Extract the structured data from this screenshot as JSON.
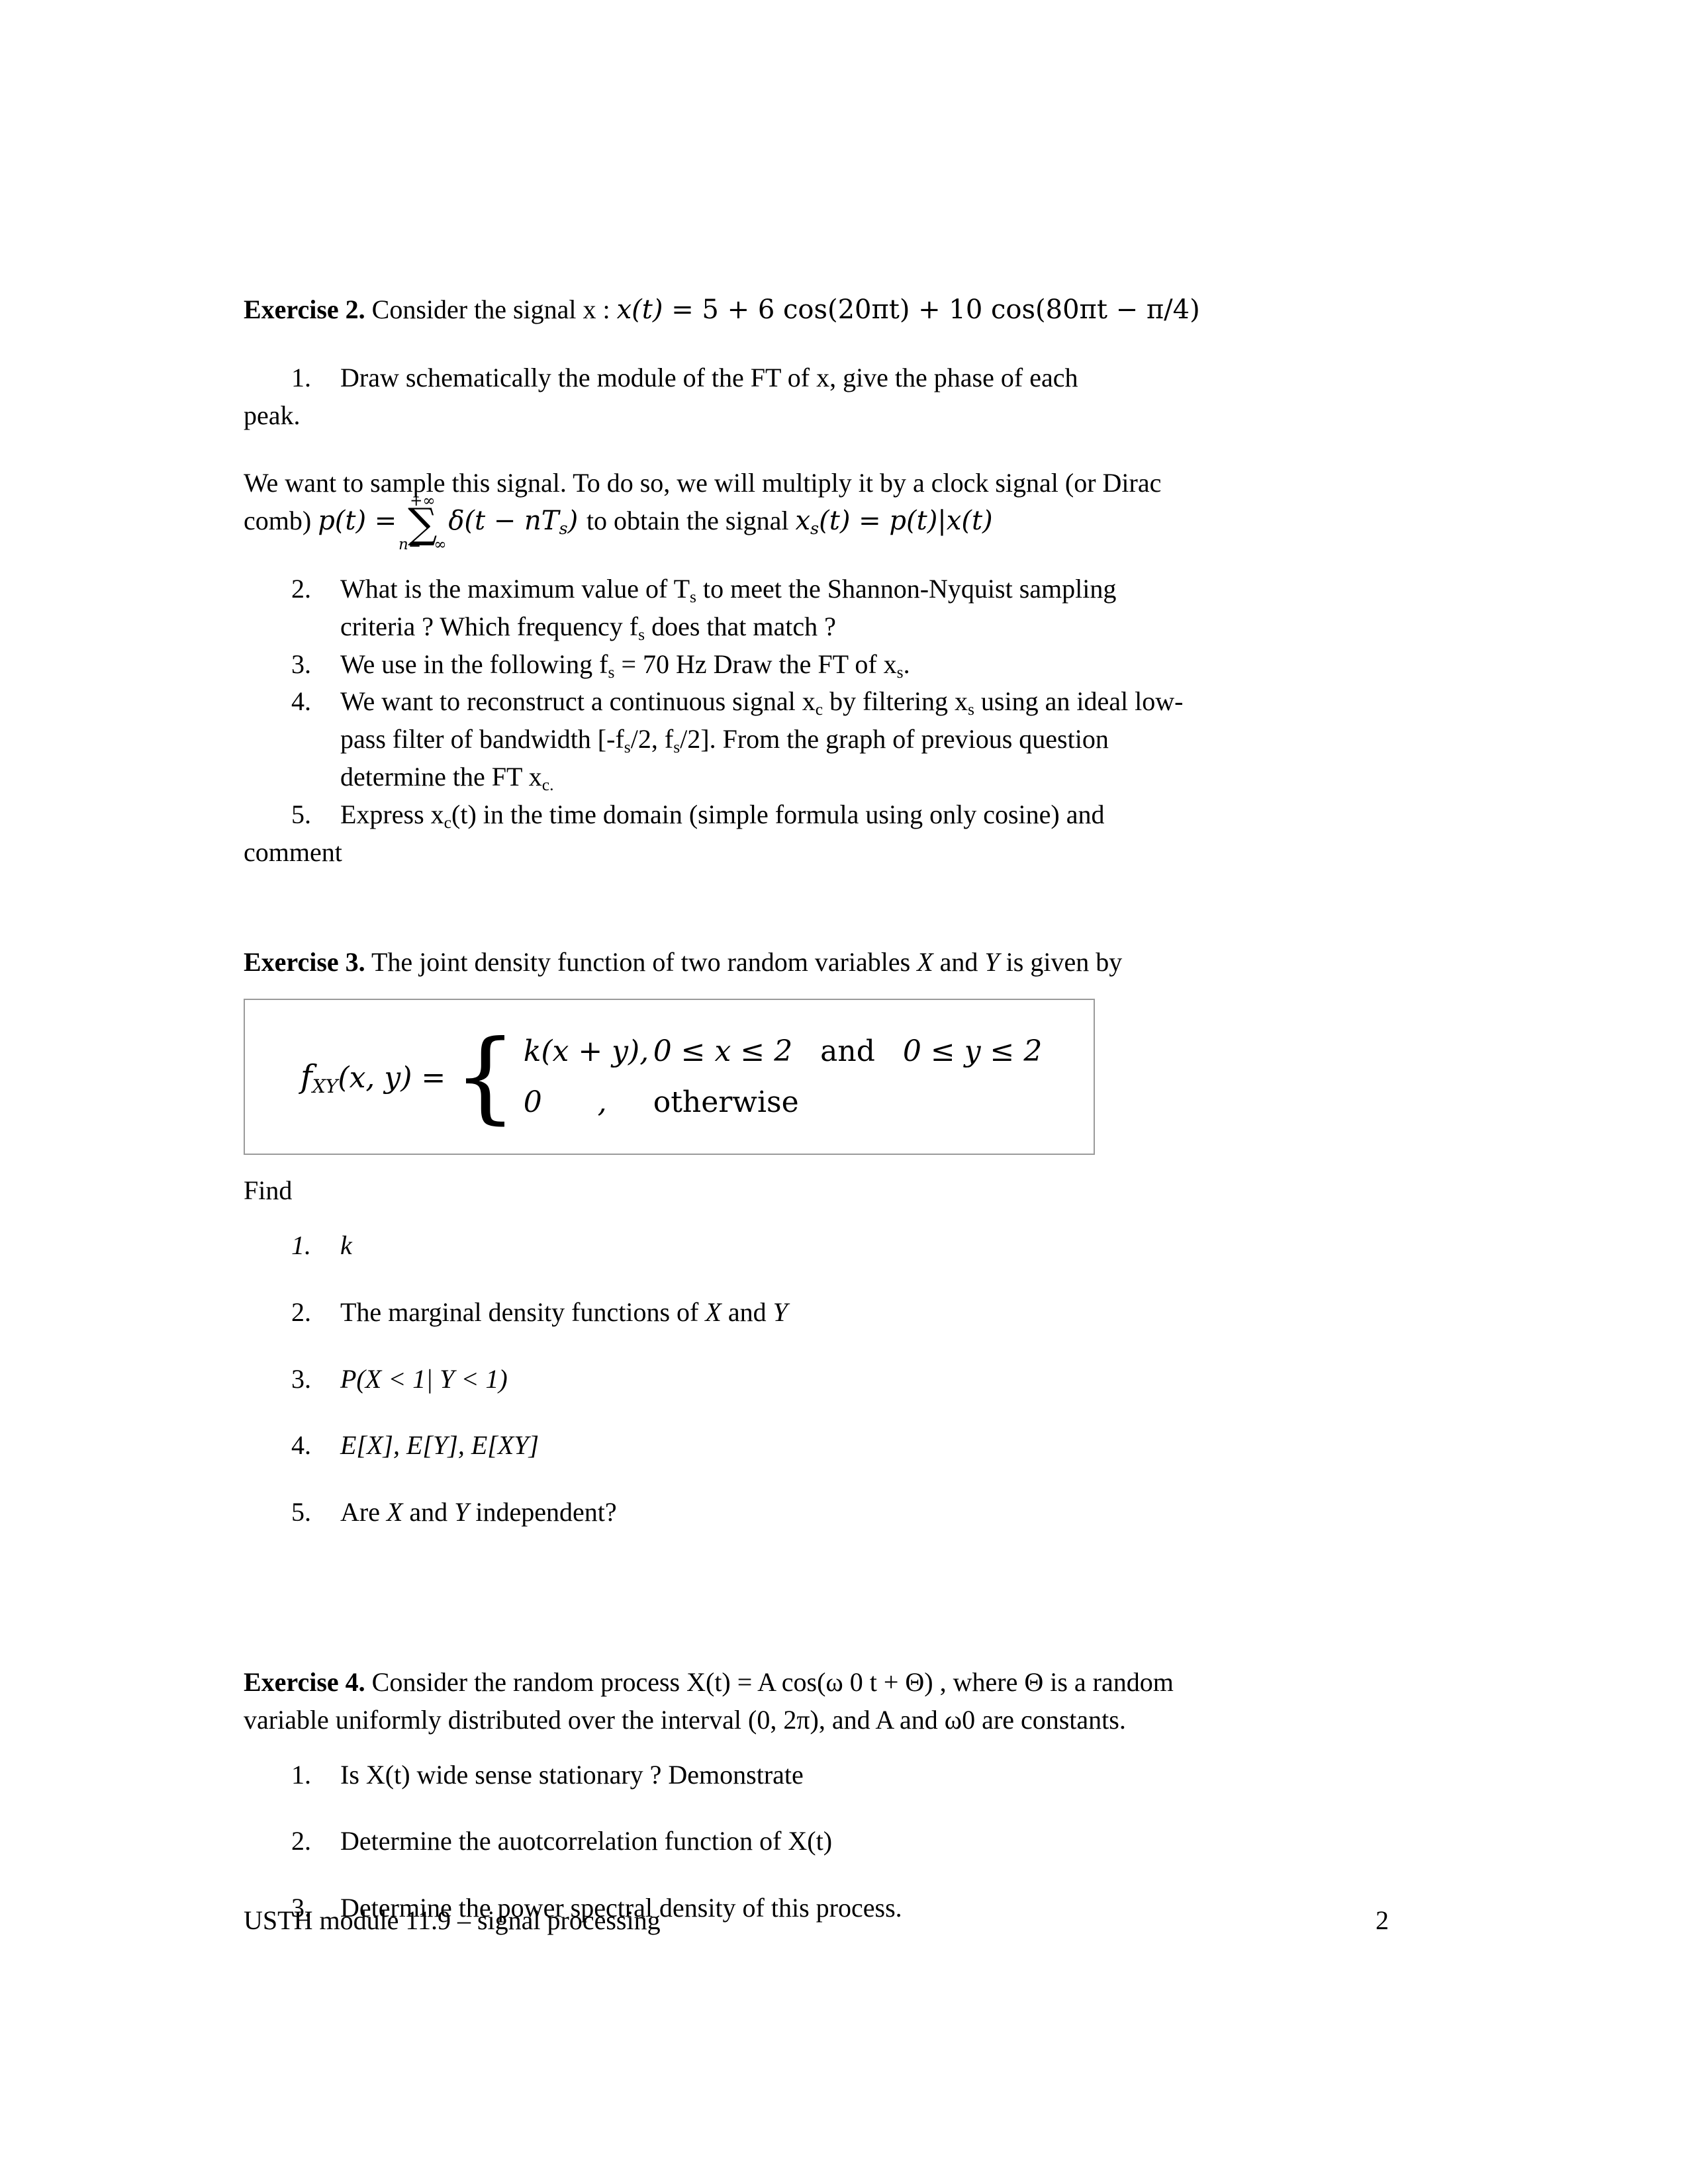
{
  "document": {
    "page_number": "2",
    "footer_text": "USTH module 11.9 – signal processing"
  },
  "exercise2": {
    "label": "Exercise 2.",
    "intro": "Consider the signal x :",
    "signal_formula": {
      "lhs": "x(t)",
      "eq": "=",
      "rhs": "5 + 6 cos(20πt) + 10 cos(80πt − π/4)"
    },
    "q1": "Draw schematically the module of the FT of x, give the phase of each",
    "q1_cont": "peak.",
    "sampling_para_1": "We want to sample this signal. To do so, we will multiply it by a clock signal (or Dirac",
    "sampling_para_2_prefix": "comb)",
    "comb_formula": {
      "lhs": "p(t)",
      "eq": "=",
      "sum_upper": "+∞",
      "sum_lower": "n=−∞",
      "term": "δ(t − nT",
      "term_sub": "s",
      "term_close": ")"
    },
    "sampling_para_2_mid": "to obtain the signal",
    "sampled_formula": {
      "lhs": "x",
      "lhs_sub": "s",
      "lhs_arg": "(t)",
      "eq": "=",
      "rhs": "p(t)|x(t)"
    },
    "questions": [
      {
        "num": "2.",
        "line1_a": "What is the maximum value of T",
        "line1_sub": "s",
        "line1_b": " to meet the Shannon-Nyquist sampling",
        "line2_a": "criteria ? Which frequency f",
        "line2_sub": "s",
        "line2_b": " does that match ?"
      },
      {
        "num": "3.",
        "line1_a": "We use in the following f",
        "line1_sub": "s",
        "line1_b": " = 70 Hz Draw the FT of x",
        "line1_sub2": "s",
        "line1_c": "."
      },
      {
        "num": "4.",
        "line1_a": "We want to reconstruct a continuous signal x",
        "line1_sub": "c",
        "line1_b": " by filtering x",
        "line1_sub2": "s",
        "line1_c": " using an ideal low-",
        "line2_a": "pass filter of bandwidth [-f",
        "line2_sub": "s",
        "line2_b": "/2, f",
        "line2_sub2": "s",
        "line2_c": "/2]. From the graph of previous question",
        "line3_a": "determine the FT x",
        "line3_sub": "c.",
        "line3_b": ""
      },
      {
        "num": "5.",
        "line1_a": "Express x",
        "line1_sub": "c",
        "line1_b": "(t) in the time domain (simple formula using only cosine) and"
      }
    ],
    "q5_cont": "comment"
  },
  "exercise3": {
    "label": "Exercise 3.",
    "intro_a": "The joint density function of two random variables ",
    "intro_x": "X",
    "intro_b": " and ",
    "intro_y": "Y",
    "intro_c": " is given by",
    "formula": {
      "lhs_f": "f",
      "lhs_sub": "XY",
      "lhs_args": "(x, y)",
      "eq": "=",
      "case1_value": "k(x + y),",
      "case1_condition_a": "0 ≤ x ≤ 2",
      "case1_condition_and": "and",
      "case1_condition_b": "0 ≤ y ≤ 2",
      "case2_value": "0",
      "case2_comma": ",",
      "case2_condition": "otherwise"
    },
    "find_label": "Find",
    "items": [
      {
        "num": "1.",
        "text": "k",
        "italic": true
      },
      {
        "num": "2.",
        "text_a": "The marginal density functions of ",
        "text_x": "X",
        "text_b": " and ",
        "text_y": "Y",
        "italic": false
      },
      {
        "num": "3.",
        "text": "P(X < 1| Y < 1)",
        "italic": true
      },
      {
        "num": "4.",
        "text": "E[X], E[Y], E[XY]",
        "italic": true
      },
      {
        "num": "5.",
        "text_a": "Are ",
        "text_x": "X",
        "text_b": " and ",
        "text_y": "Y",
        "text_c": " independent?",
        "italic": false
      }
    ]
  },
  "exercise4": {
    "label": "Exercise 4.",
    "intro_line1": "Consider the random process X(t) = A cos(ω 0 t + Θ) , where Θ is a random",
    "intro_line2": "variable uniformly distributed over the interval (0, 2π), and A and ω0 are constants.",
    "items": [
      {
        "num": "1.",
        "text": "Is X(t) wide sense stationary ? Demonstrate"
      },
      {
        "num": "2.",
        "text": "Determine the auotcorrelation function of X(t)"
      },
      {
        "num": "3.",
        "text": "Determine the power spectral density of this process."
      }
    ]
  }
}
